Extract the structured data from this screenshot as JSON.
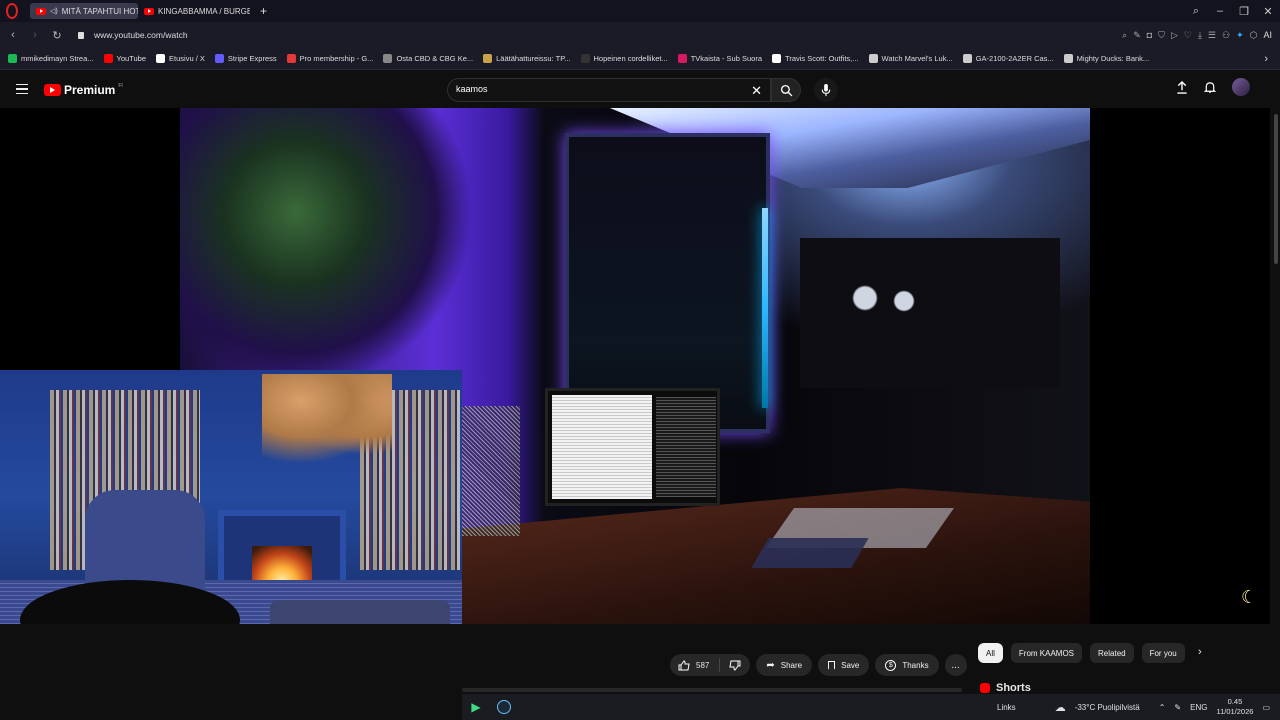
{
  "browser": {
    "tabs": [
      {
        "label": "MITÄ TAPAHTUI HOTE",
        "active": true
      },
      {
        "label": "KINGABBAMMA / BURGE",
        "active": false
      }
    ],
    "new_tab": "+",
    "url": "www.youtube.com/watch",
    "ai_label": "AI",
    "bookmarks": [
      {
        "label": "mmikedimayn Strea...",
        "icon": "green-square",
        "color": "#1db954"
      },
      {
        "label": "YouTube",
        "icon": "youtube",
        "color": "#ff0000"
      },
      {
        "label": "Etusivu / X",
        "icon": "x-logo",
        "color": "#ffffff"
      },
      {
        "label": "Stripe Express",
        "icon": "stripe",
        "color": "#635bff"
      },
      {
        "label": "Pro membership - G...",
        "icon": "location-pin",
        "color": "#e53935"
      },
      {
        "label": "Osta CBD & CBG Ke...",
        "icon": "circle",
        "color": "#888888"
      },
      {
        "label": "Läätähattureissu: TP...",
        "icon": "hat",
        "color": "#c8a24a"
      },
      {
        "label": "Hopeinen cordelliket...",
        "icon": "nt",
        "color": "#333333"
      },
      {
        "label": "TVkaista - Sub Suora",
        "icon": "tv",
        "color": "#d81b60"
      },
      {
        "label": "Travis Scott: Outfits,...",
        "icon": "w",
        "color": "#ffffff"
      },
      {
        "label": "Watch Marvel's Luk...",
        "icon": "swirl",
        "color": "#cccccc"
      },
      {
        "label": "GA-2100-2A2ER Cas...",
        "icon": "watch",
        "color": "#cccccc"
      },
      {
        "label": "Mighty Ducks: Bank...",
        "icon": "bolt",
        "color": "#cccccc"
      }
    ]
  },
  "youtube": {
    "logo_text": "Premium",
    "logo_sup": "FI",
    "search_value": "kaamos",
    "actions": {
      "likes": "587",
      "share": "Share",
      "save": "Save",
      "thanks": "Thanks",
      "more": "..."
    },
    "chips": [
      "All",
      "From KAAMOS",
      "Related",
      "For you"
    ],
    "shorts_label": "Shorts"
  },
  "taskbar": {
    "links": "Links",
    "weather": "-33°C  Puolipilvistä",
    "lang": "ENG",
    "time": "0.45",
    "date": "11/01/2026"
  }
}
